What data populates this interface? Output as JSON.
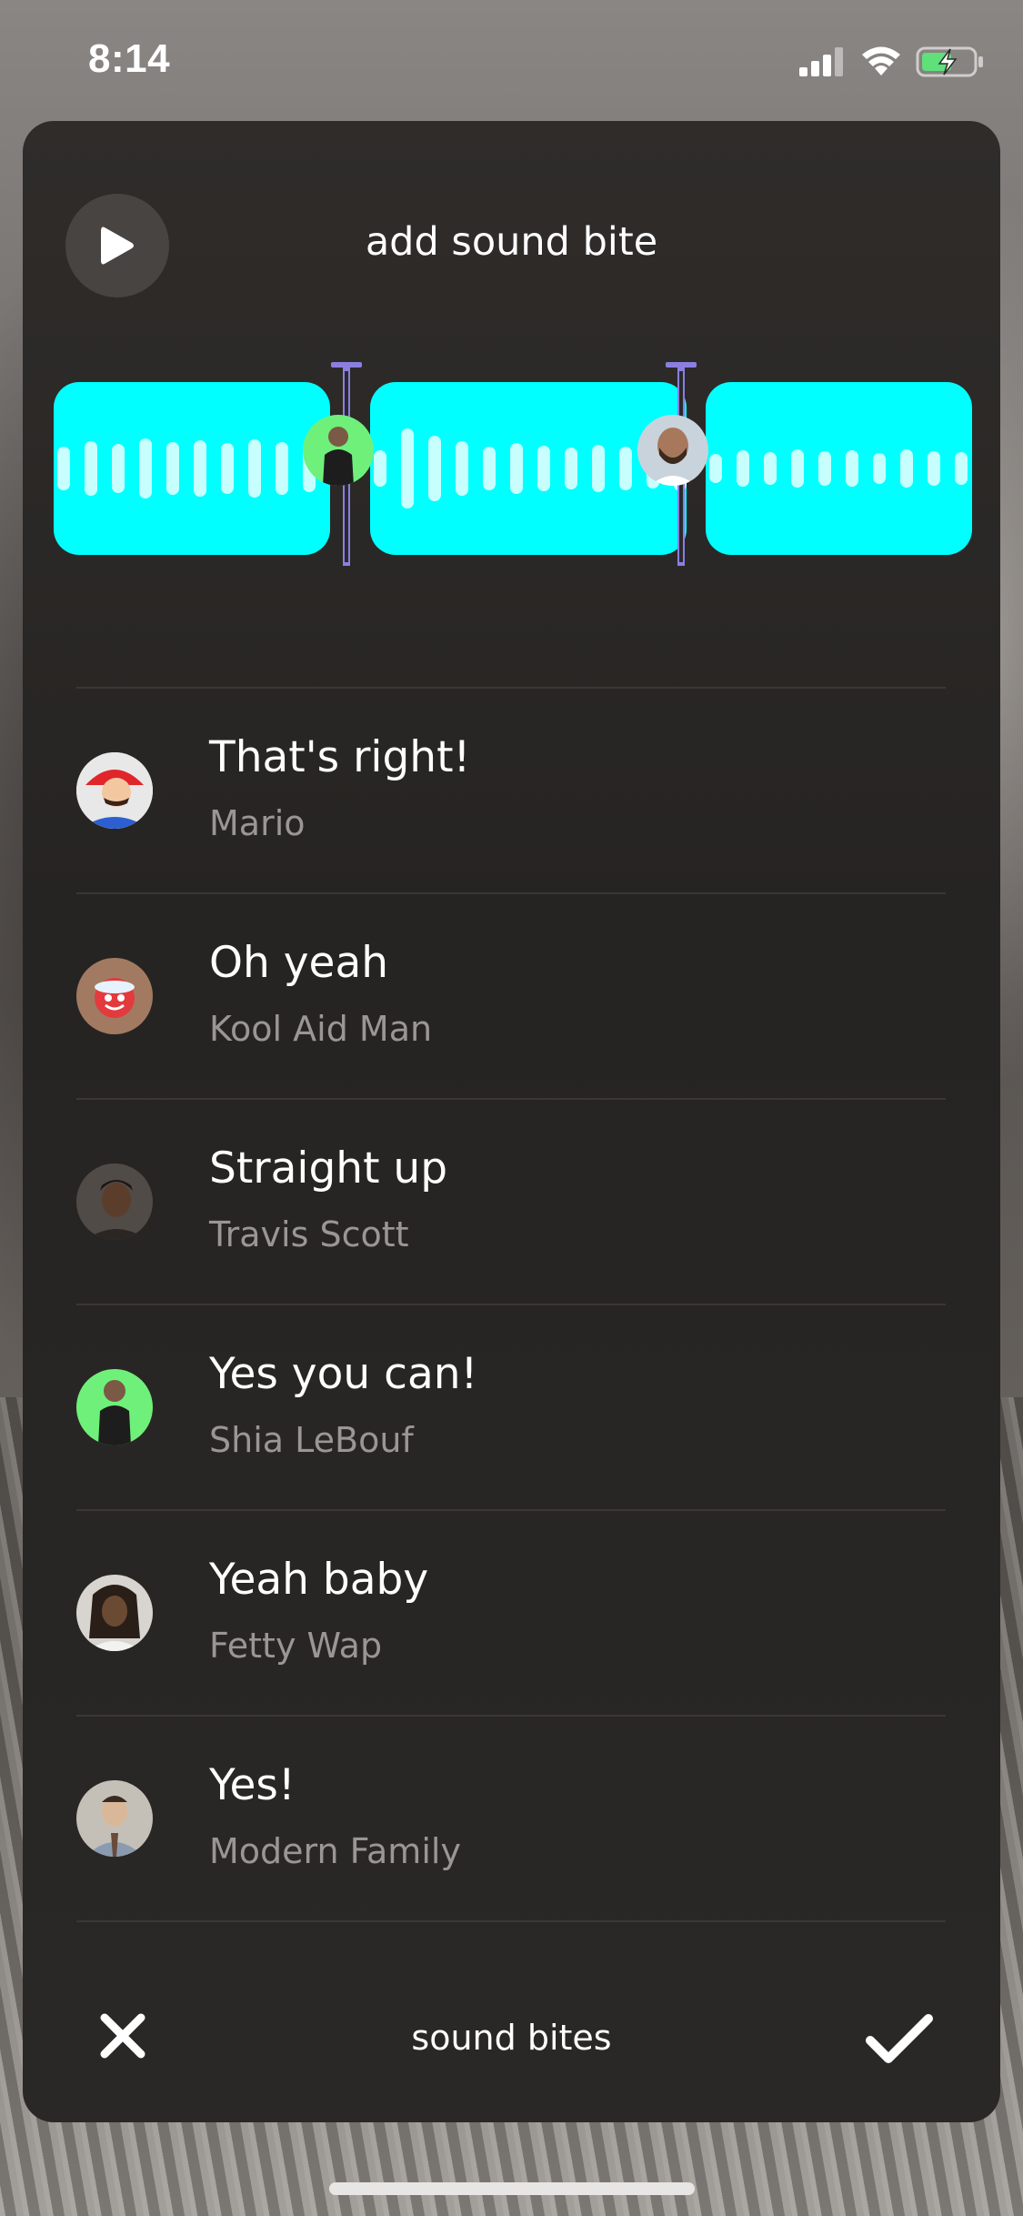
{
  "status_bar": {
    "time": "8:14",
    "icons": [
      "signal-icon",
      "wifi-icon",
      "battery-charging-icon"
    ]
  },
  "header": {
    "title": "add sound bite",
    "play_icon": "play-icon"
  },
  "waveform": {
    "segment_color": "#00ffff",
    "marker_color": "#8a7fe0",
    "markers": [
      {
        "avatar_of": "Shia LeBouf"
      },
      {
        "avatar_of": "Drake"
      }
    ]
  },
  "sound_bites": [
    {
      "title": "That's right!",
      "source": "Mario",
      "avatar_color": "#d9332b"
    },
    {
      "title": "Oh yeah",
      "source": "Kool Aid Man",
      "avatar_color": "#c8d6e6"
    },
    {
      "title": "Straight up",
      "source": "Travis Scott",
      "avatar_color": "#4d4744"
    },
    {
      "title": "Yes you can!",
      "source": "Shia LeBouf",
      "avatar_color": "#6ff07a"
    },
    {
      "title": "Yeah baby",
      "source": "Fetty Wap",
      "avatar_color": "#5a4636"
    },
    {
      "title": "Yes!",
      "source": "Modern Family",
      "avatar_color": "#b8b6b0"
    }
  ],
  "footer": {
    "label": "sound bites",
    "close_icon": "close-icon",
    "confirm_icon": "checkmark-icon"
  }
}
